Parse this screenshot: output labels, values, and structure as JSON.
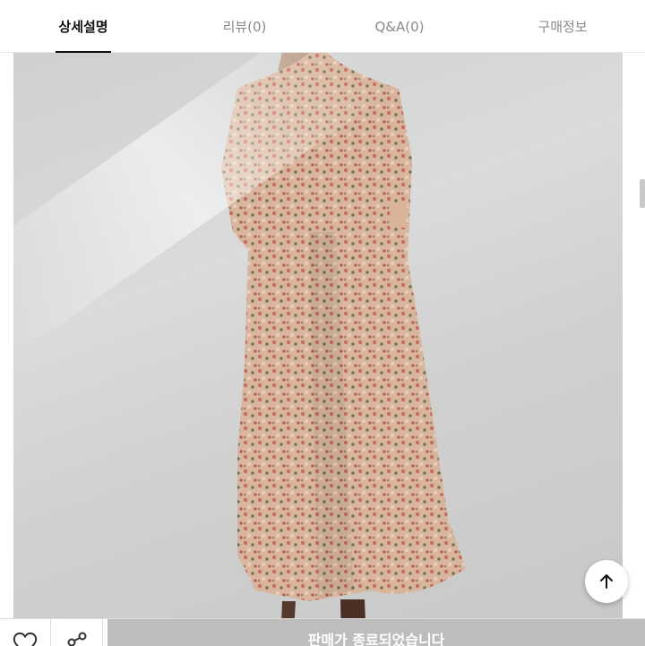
{
  "tabs": [
    {
      "label": "상세설명",
      "active": true
    },
    {
      "label": "리뷰(0)",
      "active": false
    },
    {
      "label": "Q&A(0)",
      "active": false
    },
    {
      "label": "구매정보",
      "active": false
    }
  ],
  "bottom_bar": {
    "status_label": "판매가 종료되었습니다"
  },
  "colors": {
    "accent": "#111111",
    "sold_out_bg": "#bdbdbd"
  }
}
